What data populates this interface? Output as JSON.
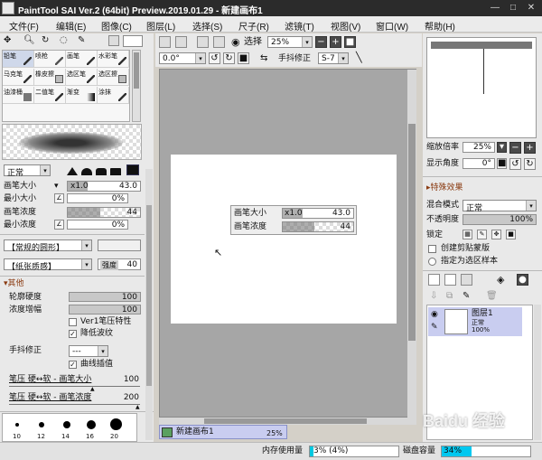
{
  "window": {
    "title": "PaintTool SAI Ver.2 (64bit) Preview.2019.01.29 - 新建画布1",
    "min": "—",
    "max": "□",
    "close": "✕"
  },
  "menu": [
    "文件(F)",
    "编辑(E)",
    "图像(C)",
    "图层(L)",
    "选择(S)",
    "尺子(R)",
    "滤镜(T)",
    "视图(V)",
    "窗口(W)",
    "帮助(H)"
  ],
  "toolbar": {
    "select_label": "选择",
    "zoom": "25%",
    "angle": "0.0°",
    "stabilizer_label": "手抖修正",
    "stabilizer_value": "S-7"
  },
  "tools": [
    "铅笔",
    "喷枪",
    "画笔",
    "水彩笔",
    "马克笔",
    "橡皮擦",
    "选区笔",
    "选区擦",
    "油漆桶",
    "二值笔",
    "渐变",
    "涂抹"
  ],
  "brush": {
    "blend_mode": "正常",
    "size_label": "画笔大小",
    "size_mult": "x1.0",
    "size_value": "43.0",
    "min_size_label": "最小大小",
    "min_size_value": "0%",
    "density_label": "画笔浓度",
    "density_value": "44",
    "min_density_label": "最小浓度",
    "min_density_value": "0%",
    "shape_dropdown": "【常规的圆形】",
    "texture_dropdown": "【纸张质感】",
    "texture_strength_label": "强度",
    "texture_strength": "40",
    "other_header": "其他",
    "edge_hardness_label": "轮廓硬度",
    "edge_hardness_value": "100",
    "density_gain_label": "浓度增幅",
    "density_gain_value": "100",
    "ver1_label": "Ver1笔压特性",
    "reduce_noise_label": "降低波纹",
    "stabilizer_label": "手抖修正",
    "stabilizer_value": "---",
    "curve_label": "曲线插值",
    "pressure_size_label": "笔压 硬↔软 - 画笔大小",
    "pressure_size_value": "100",
    "pressure_density_label": "笔压 硬↔软 - 画笔浓度",
    "pressure_density_value": "200",
    "dot_sizes": [
      "10",
      "12",
      "14",
      "16",
      "20"
    ]
  },
  "canvas_popup": {
    "size_label": "画笔大小",
    "size_mult": "x1.0",
    "size_value": "43.0",
    "density_label": "画笔浓度",
    "density_value": "44"
  },
  "canvas_tab": {
    "name": "新建画布1",
    "zoom": "25%"
  },
  "status": {
    "memory_label": "内存使用量",
    "memory_value": "3% (4%)",
    "disk_label": "磁盘容量",
    "disk_value": "34%",
    "disk_fill": 0.34
  },
  "navigator": {
    "zoom_label": "缩放倍率",
    "zoom_value": "25%",
    "angle_label": "显示角度",
    "angle_value": "0°"
  },
  "layer_effects": {
    "header": "特殊效果",
    "blend_label": "混合模式",
    "blend_value": "正常",
    "opacity_label": "不透明度",
    "opacity_value": "100%",
    "lock_label": "锁定",
    "clip_label": "创建剪贴蒙版",
    "selection_label": "指定为选区样本"
  },
  "layer": {
    "name": "图层1",
    "mode": "正常",
    "opacity": "100%"
  },
  "watermark": "Baidu 经验"
}
